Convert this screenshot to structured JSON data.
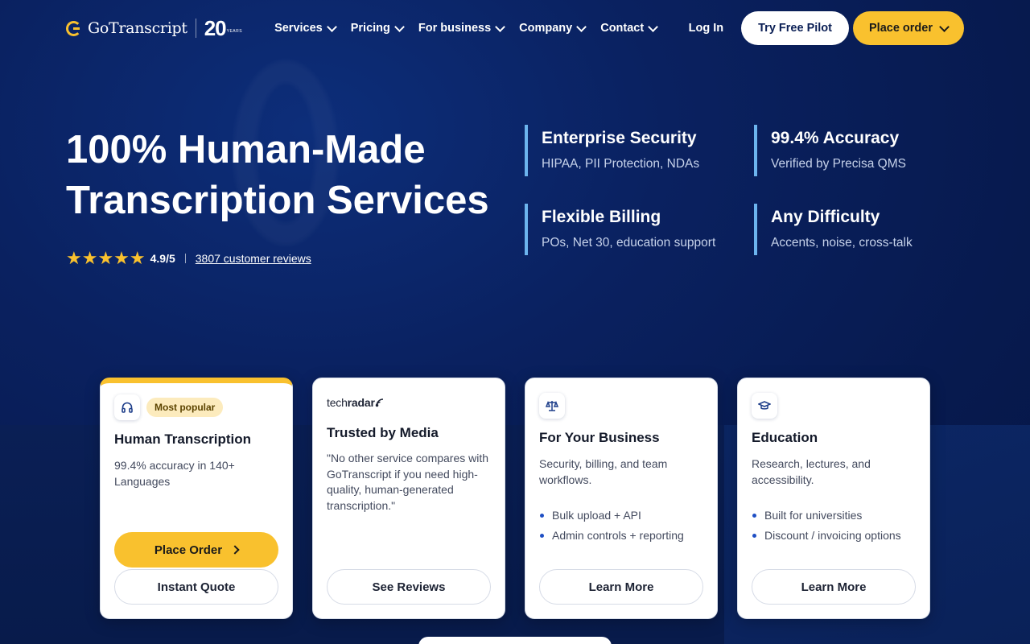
{
  "nav": {
    "logo": {
      "name": "GoTranscript",
      "anniversary": "20",
      "anniversary_label": "YEARS"
    },
    "menu": [
      {
        "label": "Services"
      },
      {
        "label": "Pricing"
      },
      {
        "label": "For business"
      },
      {
        "label": "Company"
      },
      {
        "label": "Contact"
      }
    ],
    "login": "Log In",
    "try_pilot": "Try Free Pilot",
    "place_order": "Place order"
  },
  "hero": {
    "title_line1": "100% Human-Made",
    "title_line2": "Transcription Services",
    "stars": "★★★★★",
    "rating": "4.9/5",
    "reviews_link": "3807 customer reviews"
  },
  "features": [
    {
      "title": "Enterprise Security",
      "subtitle": "HIPAA, PII Protection, NDAs"
    },
    {
      "title": "99.4% Accuracy",
      "subtitle": "Verified by Precisa QMS"
    },
    {
      "title": "Flexible Billing",
      "subtitle": "POs, Net 30, education support"
    },
    {
      "title": "Any Difficulty",
      "subtitle": "Accents, noise, cross-talk"
    }
  ],
  "cards": {
    "human": {
      "badge": "Most popular",
      "title": "Human Transcription",
      "desc": "99.4% accuracy in 140+ Languages",
      "primary": "Place Order",
      "secondary": "Instant Quote"
    },
    "media": {
      "brand_light": "tech",
      "brand_bold": "radar",
      "title": "Trusted by Media",
      "quote": "\"No other service compares with GoTranscript if you need high-quality, human-generated transcription.\"",
      "secondary": "See Reviews"
    },
    "business": {
      "title": "For Your Business",
      "desc": "Security, billing, and team workflows.",
      "bullets": [
        "Bulk upload + API",
        "Admin controls + reporting"
      ],
      "secondary": "Learn More"
    },
    "education": {
      "title": "Education",
      "desc": "Research, lectures, and accessibility.",
      "bullets": [
        "Built for universities",
        "Discount / invoicing options"
      ],
      "secondary": "Learn More"
    }
  },
  "colors": {
    "accent": "#f9c12e",
    "navy": "#0a2160",
    "feature_bar": "#6cb4ee"
  }
}
